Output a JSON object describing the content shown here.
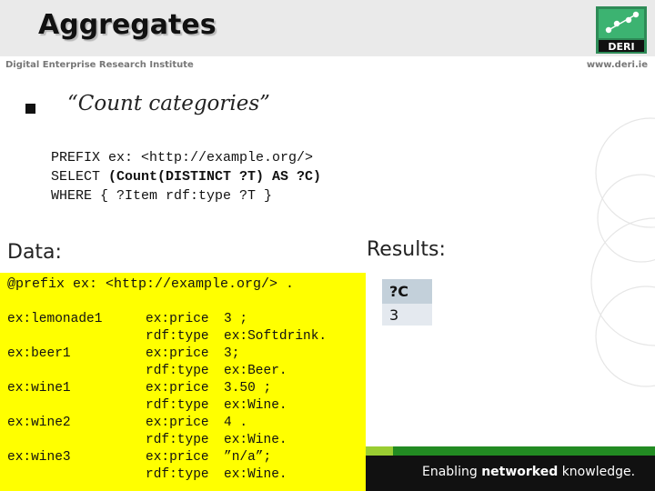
{
  "header": {
    "title": "Aggregates",
    "subtitle_left": "Digital Enterprise Research Institute",
    "subtitle_right": "www.deri.ie",
    "logo_text": "DERI"
  },
  "bullet": {
    "text": "“Count categories”"
  },
  "query": {
    "line1": "PREFIX ex: <http://example.org/>",
    "line2_prefix": "SELECT ",
    "line2_bold": "(Count(DISTINCT ?T) AS ?C)",
    "line3": "WHERE { ?Item rdf:type ?T }"
  },
  "data_section": {
    "label": "Data:",
    "prefix_line": "@prefix ex: <http://example.org/> .",
    "rows": [
      {
        "subject": "ex:lemonade1",
        "predicate": "ex:price",
        "object": "3 ;"
      },
      {
        "subject": "",
        "predicate": "rdf:type",
        "object": "ex:Softdrink."
      },
      {
        "subject": "ex:beer1",
        "predicate": "ex:price",
        "object": "3;"
      },
      {
        "subject": "",
        "predicate": "rdf:type",
        "object": "ex:Beer."
      },
      {
        "subject": "ex:wine1",
        "predicate": "ex:price",
        "object": "3.50 ;"
      },
      {
        "subject": "",
        "predicate": "rdf:type",
        "object": "ex:Wine."
      },
      {
        "subject": "ex:wine2",
        "predicate": "ex:price",
        "object": "4 ."
      },
      {
        "subject": "",
        "predicate": "rdf:type",
        "object": "ex:Wine."
      },
      {
        "subject": "ex:wine3",
        "predicate": "ex:price",
        "object": "”n/a”;"
      },
      {
        "subject": "",
        "predicate": "rdf:type",
        "object": "ex:Wine."
      }
    ]
  },
  "results_section": {
    "label": "Results:",
    "header": "?C",
    "value": "3"
  },
  "footer": {
    "tagline_start": "Enabling ",
    "tagline_bold": "networked",
    "tagline_end": " knowledge."
  },
  "colors": {
    "data_background": "#ffff00",
    "results_header": "#c3d0da",
    "results_cell": "#e4e9ef",
    "footer": "#111111",
    "accent_green": "#228b22"
  }
}
